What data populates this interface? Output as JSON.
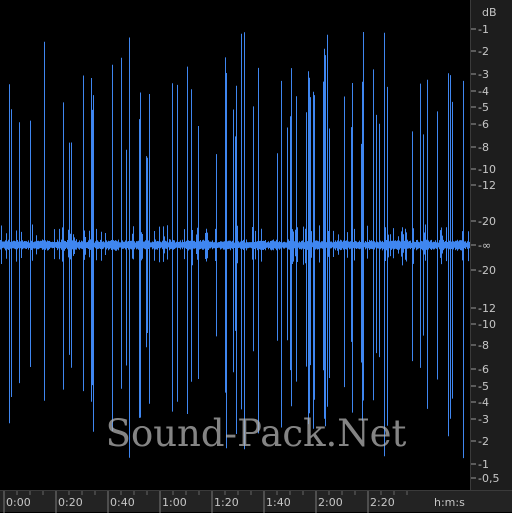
{
  "db_scale": {
    "unit": "dB",
    "labels": [
      "-1",
      "-2",
      "-3",
      "-4",
      "-5",
      "-6",
      "-8",
      "-10",
      "-12",
      "-20",
      "-∞",
      "-20",
      "-12",
      "-10",
      "-8",
      "-6",
      "-5",
      "-4",
      "-3",
      "-2",
      "-1",
      "-0,5"
    ]
  },
  "time_scale": {
    "labels": [
      "0:00",
      "0:20",
      "0:40",
      "1:00",
      "1:20",
      "1:40",
      "2:00",
      "2:20"
    ],
    "unit": "h:m:s"
  },
  "watermark": "Sound-Pack.Net",
  "colors": {
    "waveform": "#3f86f0",
    "background": "#000000",
    "ruler_bg": "#1d1d1d",
    "ruler_text": "#c6c6c6"
  }
}
